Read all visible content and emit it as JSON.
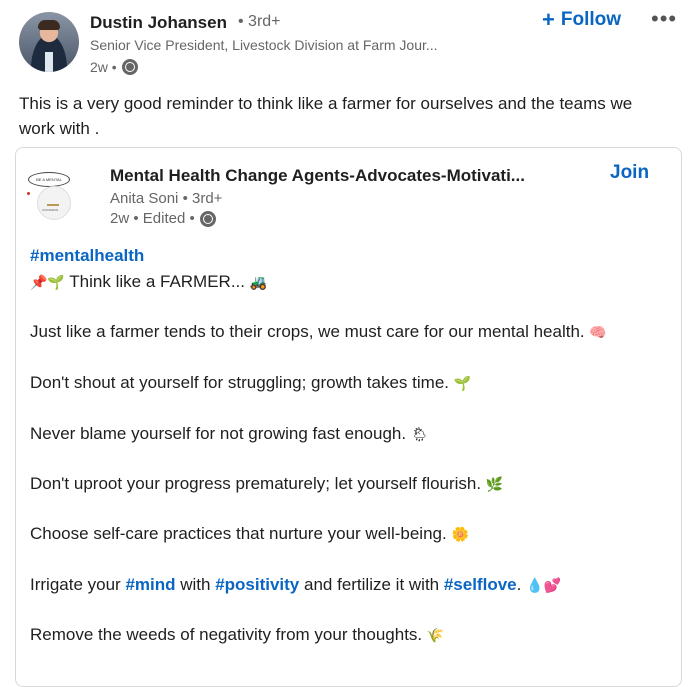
{
  "author": {
    "name": "Dustin Johansen",
    "degree": "• 3rd+",
    "headline": "Senior Vice President, Livestock Division at Farm Jour...",
    "time": "2w •"
  },
  "actions": {
    "follow_label": "Follow",
    "follow_icon": "+",
    "more": "•••"
  },
  "post_text": "This is a very good reminder to think like a farmer for ourselves and the teams we work with .",
  "shared": {
    "group_title": "Mental Health Change Agents-Advocates-Motivati...",
    "author": "Anita Soni",
    "degree": "• 3rd+",
    "time": "2w • Edited •",
    "join_label": "Join",
    "logo_text": "COGNIZON",
    "bubble_text": "BE A MENTAL HEALTH"
  },
  "body": {
    "hashtag": "#mentalhealth",
    "line1_emoji": "📌🌱",
    "line1": "Think like a FARMER...",
    "line1_end": "🚜",
    "line2": "Just like a farmer tends to their crops, we must care for our mental health.",
    "line2_emoji": "🧠",
    "line3": "Don't shout at yourself for struggling; growth takes time.",
    "line3_emoji": "🌱",
    "line4": "Never blame yourself for not growing fast enough.",
    "line4_emoji": "🌦",
    "line5": "Don't uproot your progress prematurely; let yourself flourish.",
    "line5_emoji": "🌿",
    "line6": "Choose self-care practices that nurture your well-being.",
    "line6_emoji": "🌼",
    "line7_a": "Irrigate your ",
    "line7_tag1": "#mind",
    "line7_b": " with ",
    "line7_tag2": "#positivity",
    "line7_c": " and fertilize it with ",
    "line7_tag3": "#selflove",
    "line7_d": ".",
    "line7_emoji": "💧💕",
    "line8": "Remove the weeds of negativity from your thoughts.",
    "line8_emoji": "🌾"
  }
}
